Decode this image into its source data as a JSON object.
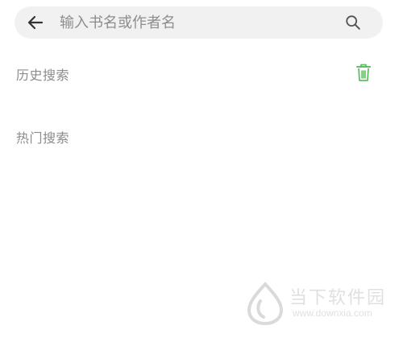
{
  "search": {
    "placeholder": "输入书名或作者名",
    "value": ""
  },
  "icons": {
    "back": "arrow-left-icon",
    "search": "magnifier-icon",
    "trash": "trash-icon"
  },
  "sections": {
    "history_label": "历史搜索",
    "hot_label": "热门搜索"
  },
  "watermark": {
    "text": "当下软件园",
    "url": "www.downxia.com"
  },
  "colors": {
    "search_bar_bg": "#f1f1f1",
    "label_gray": "#8c8c8c",
    "trash_green": "#5fbf63",
    "watermark_gray": "#c7c7c7"
  }
}
